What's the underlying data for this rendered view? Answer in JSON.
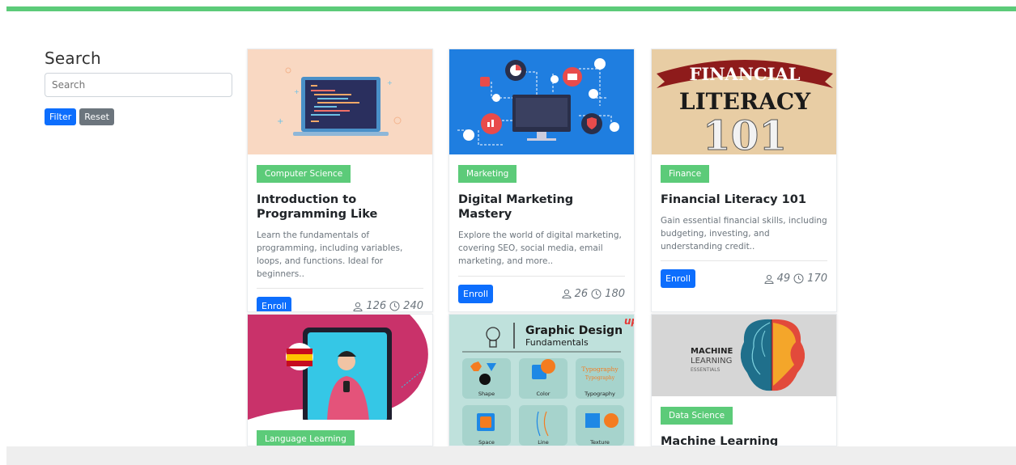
{
  "sidebar": {
    "title": "Search",
    "search_placeholder": "Search",
    "filter_label": "Filter",
    "reset_label": "Reset"
  },
  "courses": [
    {
      "category": "Computer Science",
      "title": "Introduction to Programming Like",
      "description": "Learn the fundamentals of programming, including variables, loops, and functions. Ideal for beginners..",
      "enroll_label": "Enroll",
      "students": "126",
      "hours": "240"
    },
    {
      "category": "Marketing",
      "title": "Digital Marketing Mastery",
      "description": "Explore the world of digital marketing, covering SEO, social media, email marketing, and more..",
      "enroll_label": "Enroll",
      "students": "26",
      "hours": "180"
    },
    {
      "category": "Finance",
      "title": "Financial Literacy 101",
      "description": "Gain essential financial skills, including budgeting, investing, and understanding credit..",
      "enroll_label": "Enroll",
      "students": "49",
      "hours": "170"
    },
    {
      "category": "Language Learning"
    },
    {
      "image_title": "Graphic Design",
      "image_subtitle": "Fundamentals",
      "image_logo": "up",
      "tiles": [
        "Shape",
        "Color",
        "Typography",
        "Space",
        "Line",
        "Texture"
      ]
    },
    {
      "category": "Data Science",
      "title": "Machine Learning Essentials",
      "image_text": [
        "MACHINE",
        "LEARNING",
        "ESSENTIALS"
      ]
    }
  ],
  "finance_image": {
    "line1": "FINANCIAL",
    "line2": "LITERACY",
    "line3": "101"
  },
  "colors": {
    "accent_green": "#5ccb79",
    "primary_blue": "#0d6efd",
    "secondary_gray": "#6c757d"
  }
}
